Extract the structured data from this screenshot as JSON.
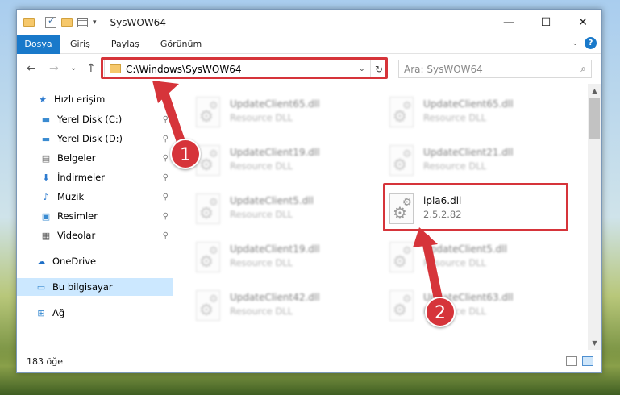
{
  "window": {
    "title": "SysWOW64",
    "controls": {
      "minimize": "—",
      "maximize": "☐",
      "close": "✕"
    }
  },
  "ribbon": {
    "tabs": [
      "Dosya",
      "Giriş",
      "Paylaş",
      "Görünüm"
    ]
  },
  "address_bar": {
    "path": "C:\\Windows\\SysWOW64",
    "refresh_icon": "↻",
    "dropdown_icon": "⌄"
  },
  "search": {
    "placeholder": "Ara: SysWOW64",
    "icon": "⌕"
  },
  "nav": {
    "back": "←",
    "forward": "→",
    "recent": "⌄",
    "up": "↑"
  },
  "sidebar": {
    "items": [
      {
        "label": "Hızlı erişim",
        "icon": "star-icon",
        "glyph": "★",
        "color": "#2e7bcf",
        "pinned": false
      },
      {
        "label": "Yerel Disk (C:)",
        "icon": "drive-icon",
        "glyph": "▬",
        "color": "#3a8bd1",
        "pinned": true
      },
      {
        "label": "Yerel Disk (D:)",
        "icon": "drive-icon",
        "glyph": "▬",
        "color": "#3a8bd1",
        "pinned": true
      },
      {
        "label": "Belgeler",
        "icon": "documents-icon",
        "glyph": "▤",
        "color": "#707070",
        "pinned": true
      },
      {
        "label": "İndirmeler",
        "icon": "download-icon",
        "glyph": "⬇",
        "color": "#2e7bcf",
        "pinned": true
      },
      {
        "label": "Müzik",
        "icon": "music-icon",
        "glyph": "♪",
        "color": "#2e7bcf",
        "pinned": true
      },
      {
        "label": "Resimler",
        "icon": "pictures-icon",
        "glyph": "▣",
        "color": "#3a8bd1",
        "pinned": true
      },
      {
        "label": "Videolar",
        "icon": "videos-icon",
        "glyph": "▦",
        "color": "#555555",
        "pinned": true
      },
      {
        "label": "OneDrive",
        "icon": "cloud-icon",
        "glyph": "☁",
        "color": "#1e6fc7",
        "pinned": false
      },
      {
        "label": "Bu bilgisayar",
        "icon": "computer-icon",
        "glyph": "▭",
        "color": "#3a8bd1",
        "pinned": false,
        "selected": true
      },
      {
        "label": "Ağ",
        "icon": "network-icon",
        "glyph": "⊞",
        "color": "#3a8bd1",
        "pinned": false
      }
    ],
    "pin_glyph": "📌"
  },
  "files": [
    {
      "name": "UpdateClient65.dll",
      "type": "Resource DLL",
      "blurred": true
    },
    {
      "name": "UpdateClient65.dll",
      "type": "Resource DLL",
      "blurred": true
    },
    {
      "name": "UpdateClient19.dll",
      "type": "Resource DLL",
      "blurred": true
    },
    {
      "name": "UpdateClient21.dll",
      "type": "Resource DLL",
      "blurred": true
    },
    {
      "name": "UpdateClient5.dll",
      "type": "Resource DLL",
      "blurred": true
    },
    {
      "name": "ipla6.dll",
      "type": "2.5.2.82",
      "blurred": false
    },
    {
      "name": "UpdateClient19.dll",
      "type": "Resource DLL",
      "blurred": true
    },
    {
      "name": "UpdateClient5.dll",
      "type": "Resource DLL",
      "blurred": true
    },
    {
      "name": "UpdateClient42.dll",
      "type": "Resource DLL",
      "blurred": true
    },
    {
      "name": "UpdateClient63.dll",
      "type": "Resource DLL",
      "blurred": true
    }
  ],
  "status": {
    "count": "183 öğe"
  },
  "callouts": [
    "1",
    "2"
  ],
  "colors": {
    "accent": "#1979ca",
    "highlight": "#d6343a",
    "selected": "#cce8ff"
  }
}
